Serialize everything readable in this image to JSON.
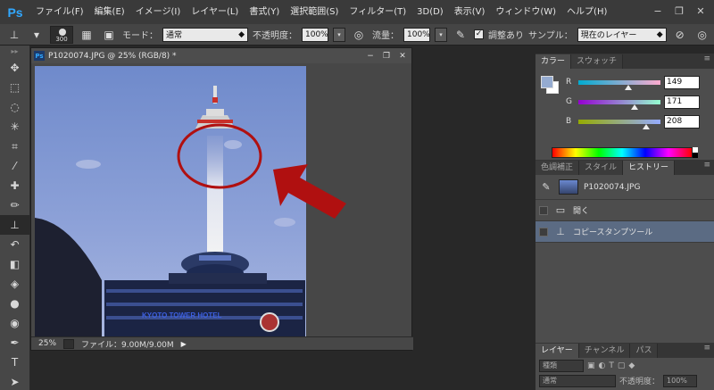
{
  "app": {
    "logo": "Ps"
  },
  "menu": [
    "ファイル(F)",
    "編集(E)",
    "イメージ(I)",
    "レイヤー(L)",
    "書式(Y)",
    "選択範囲(S)",
    "フィルター(T)",
    "3D(D)",
    "表示(V)",
    "ウィンドウ(W)",
    "ヘルプ(H)"
  ],
  "window_controls": {
    "minimize": "−",
    "restore": "❐",
    "close": "✕"
  },
  "options": {
    "brush_size": "300",
    "mode_label": "モード：",
    "mode_value": "通常",
    "opacity_label": "不透明度：",
    "opacity_value": "100%",
    "flow_label": "流量：",
    "flow_value": "100%",
    "aligned_label": "調整あり",
    "sample_label": "サンプル：",
    "sample_value": "現在のレイヤー"
  },
  "document": {
    "title": "P1020074.JPG @ 25% (RGB/8) *",
    "ps_badge": "Ps",
    "zoom": "25%",
    "file_info": "ファイル：9.00M/9.00M",
    "photo_sign": "KYOTO TOWER HOTEL"
  },
  "color_panel": {
    "tabs": [
      "カラー",
      "スウォッチ"
    ],
    "fg_color": "#95abd0",
    "r_label": "R",
    "r_value": "149",
    "g_label": "G",
    "g_value": "171",
    "b_label": "B",
    "b_value": "208"
  },
  "history_panel": {
    "tabs": [
      "色調補正",
      "スタイル",
      "ヒストリー"
    ],
    "snapshot": "P1020074.JPG",
    "items": [
      "開く",
      "コピースタンプツール"
    ]
  },
  "layers_panel": {
    "tabs": [
      "レイヤー",
      "チャンネル",
      "パス"
    ],
    "kind_label": "種類",
    "blend_mode": "通常",
    "opacity_label": "不透明度：",
    "opacity_value": "100%"
  },
  "colors": {
    "accent": "#31a8ff",
    "annotation": "#b01010",
    "selected": "#5b6b83"
  }
}
